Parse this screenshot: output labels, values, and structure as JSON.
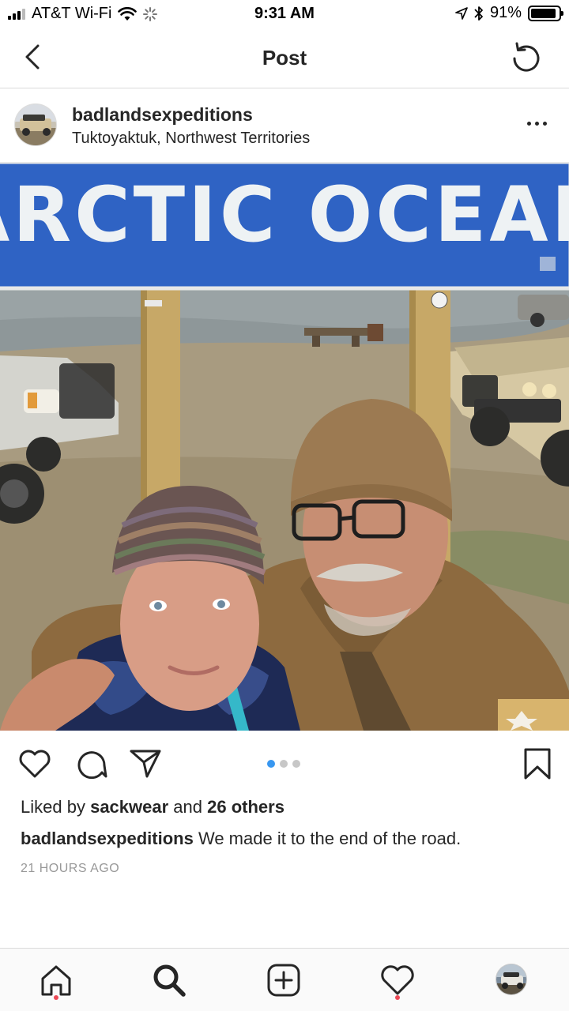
{
  "status_bar": {
    "carrier": "AT&T Wi-Fi",
    "time": "9:31 AM",
    "battery": "91%",
    "battery_level": 0.91
  },
  "nav": {
    "title": "Post",
    "back_icon": "chevron-left-icon",
    "refresh_icon": "refresh-icon"
  },
  "post": {
    "username": "badlandsexpeditions",
    "location": "Tuktoyaktuk, Northwest Territories",
    "sign_text": "ARCTIC OCEAN",
    "carousel": {
      "count": 3,
      "active": 1
    },
    "likes": {
      "prefix": "Liked by",
      "user": "sackwear",
      "connector": "and",
      "others": "26 others"
    },
    "caption": {
      "username": "badlandsexpeditions",
      "text": "We made it to the end of the road."
    },
    "timestamp": "21 HOURS AGO"
  },
  "tab_bar": {
    "items": [
      "home-icon",
      "search-icon",
      "add-post-icon",
      "activity-heart-icon",
      "profile-avatar"
    ]
  },
  "colors": {
    "accent": "#3897f0",
    "notification_dot": "#ed4956",
    "sign_blue": "#2f63c4"
  }
}
